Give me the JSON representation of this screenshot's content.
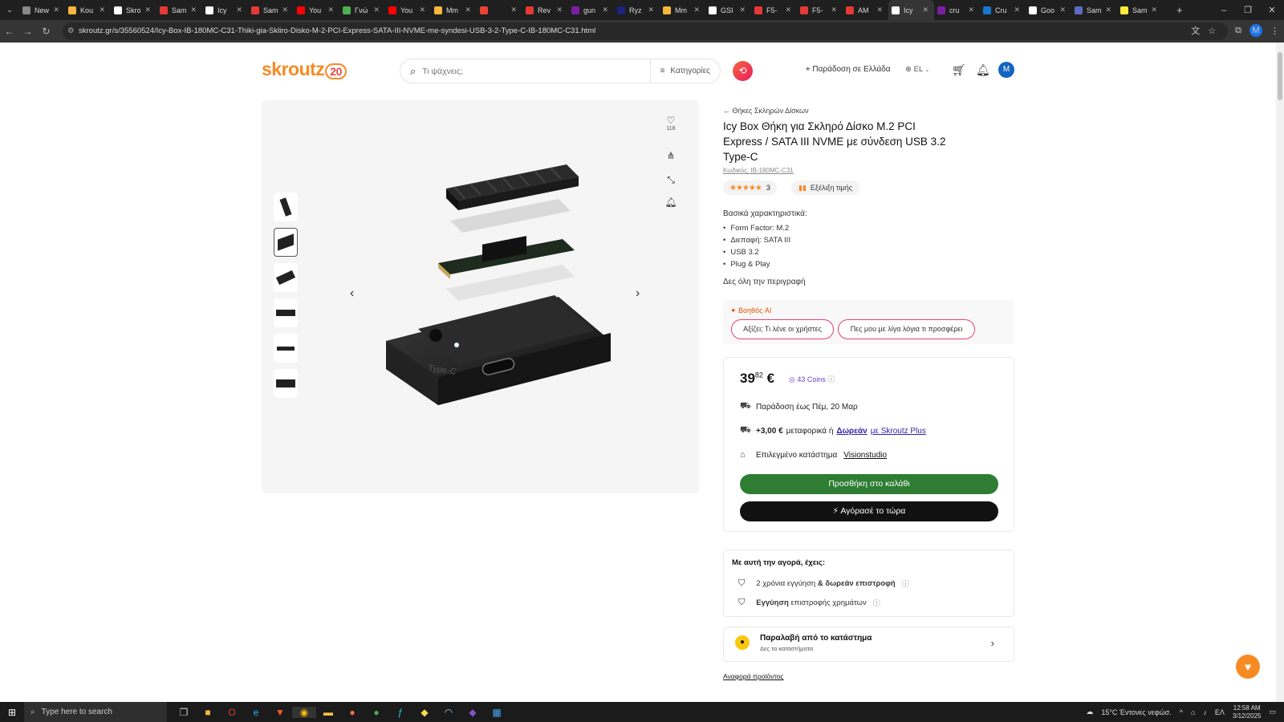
{
  "browser": {
    "tabs": [
      {
        "label": "New",
        "color": "#888"
      },
      {
        "label": "Kou",
        "color": "#f6b73c"
      },
      {
        "label": "Skro",
        "color": "#fff"
      },
      {
        "label": "Sam",
        "color": "#e53935"
      },
      {
        "label": "Icy",
        "color": "#fff"
      },
      {
        "label": "Sam",
        "color": "#e53935"
      },
      {
        "label": "You",
        "color": "#ff0000"
      },
      {
        "label": "Γνώ",
        "color": "#4caf50"
      },
      {
        "label": "You",
        "color": "#ff0000"
      },
      {
        "label": "Mm",
        "color": "#f6b73c"
      },
      {
        "label": "",
        "color": "#ea4335"
      },
      {
        "label": "Rev",
        "color": "#e53935"
      },
      {
        "label": "gun",
        "color": "#7b1fa2"
      },
      {
        "label": "Ryz",
        "color": "#1a237e"
      },
      {
        "label": "Mm",
        "color": "#f6b73c"
      },
      {
        "label": "GSI",
        "color": "#fff"
      },
      {
        "label": "F5-",
        "color": "#e53935"
      },
      {
        "label": "F5-",
        "color": "#e53935"
      },
      {
        "label": "AM",
        "color": "#e53935"
      },
      {
        "label": "Icy",
        "color": "#fff",
        "active": true
      },
      {
        "label": "cru",
        "color": "#7b1fa2"
      },
      {
        "label": "Cru",
        "color": "#1976d2"
      },
      {
        "label": "Goo",
        "color": "#fff"
      },
      {
        "label": "Sam",
        "color": "#5c6bc0"
      },
      {
        "label": "Sam",
        "color": "#ffeb3b"
      }
    ],
    "url": "skroutz.gr/s/35560524/Icy-Box-IB-180MC-C31-Thiki-gia-Skliro-Disko-M-2-PCI-Express-SATA-III-NVME-me-syndesi-USB-3-2-Type-C-IB-180MC-C31.html",
    "profile_initial": "M"
  },
  "header": {
    "logo_text": "skroutz",
    "logo_badge": "20",
    "search_placeholder": "Τι ψάχνεις;",
    "categories_label": "Κατηγορίες",
    "delivery_label": "Παράδοση σε Ελλάδα",
    "language": "EL",
    "avatar_initial": "M"
  },
  "gallery": {
    "likes_count": "118",
    "thumbnail_count": 6,
    "selected_thumbnail": 2
  },
  "product": {
    "breadcrumb": "Θήκες Σκληρών Δίσκων",
    "title": "Icy Box Θήκη για Σκληρό Δίσκο M.2 PCI Express / SATA III NVME με σύνδεση USB 3.2 Type-C",
    "code": "Κωδικός: IB-180MC-C31",
    "rating_stars": "★★★★★",
    "rating_count": "3",
    "price_history_label": "Εξέλιξη τιμής",
    "features_heading": "Βασικά χαρακτηριστικά:",
    "features": [
      "Form Factor: M.2",
      "Διεπαφή: SATA III",
      "USB 3.2",
      "Plug & Play"
    ],
    "full_description_link": "Δες όλη την περιγραφή"
  },
  "ai_helper": {
    "label": "Βοηθός AI",
    "chips": [
      "Αξίζει; Τι λένε οι χρήστες",
      "Πες μου με λίγα λόγια τι προσφέρει"
    ]
  },
  "buybox": {
    "price_int": "39",
    "price_dec": "82",
    "currency": "€",
    "coins": "43 Coins",
    "delivery_text": "Παράδοση έως Πέμ, 20 Μαρ",
    "shipping_cost": "+3,00 €",
    "shipping_text": "μεταφορικά ή",
    "free_link": "Δωρεάν",
    "plus_link": "με Skroutz Plus",
    "store_label": "Επιλεγμένο κατάστημα",
    "store_name": "Visionstudio",
    "add_to_cart": "Προσθήκη στο καλάθι",
    "buy_now": "Αγόρασέ το τώρα"
  },
  "warranty": {
    "heading": "Με αυτή την αγορά, έχεις:",
    "line1_normal": "2 χρόνια εγγύηση",
    "line1_bold": "& δωρεάν επιστροφή",
    "line2_bold": "Εγγύηση",
    "line2_normal": "επιστροφής χρημάτων"
  },
  "pickup": {
    "title": "Παραλαβή από το κατάστημα",
    "subtitle": "Δες τα καταστήματα"
  },
  "report_link": "Αναφορά προϊόντος",
  "taskbar": {
    "search_placeholder": "Type here to search",
    "weather": "15°C  Έντονες νεφώσ.",
    "lang": "ΕΛ",
    "time": "12:58 AM",
    "date": "3/12/2025"
  }
}
